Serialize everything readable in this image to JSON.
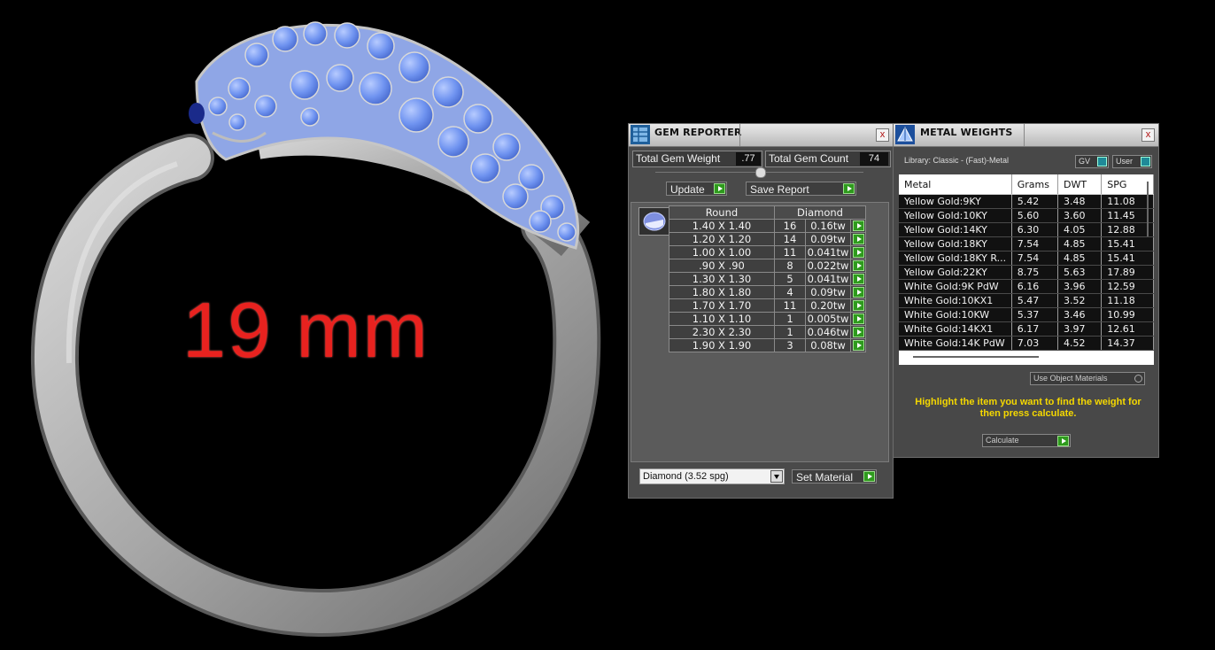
{
  "viewport": {
    "size_label": "19 mm"
  },
  "gem_reporter": {
    "title": "GEM REPORTER",
    "close": "x",
    "total_weight_label": "Total Gem Weight",
    "total_weight_value": ".77",
    "total_count_label": "Total Gem Count",
    "total_count_value": "74",
    "update_label": "Update",
    "save_report_label": "Save Report",
    "table_header": {
      "shape": "Round",
      "material": "Diamond"
    },
    "rows": [
      {
        "size": "1.40 X 1.40",
        "count": "16",
        "weight": "0.16tw"
      },
      {
        "size": "1.20 X 1.20",
        "count": "14",
        "weight": "0.09tw"
      },
      {
        "size": "1.00 X 1.00",
        "count": "11",
        "weight": "0.041tw"
      },
      {
        "size": ".90 X .90",
        "count": "8",
        "weight": "0.022tw"
      },
      {
        "size": "1.30 X 1.30",
        "count": "5",
        "weight": "0.041tw"
      },
      {
        "size": "1.80 X 1.80",
        "count": "4",
        "weight": "0.09tw"
      },
      {
        "size": "1.70 X 1.70",
        "count": "11",
        "weight": "0.20tw"
      },
      {
        "size": "1.10 X 1.10",
        "count": "1",
        "weight": "0.005tw"
      },
      {
        "size": "2.30 X 2.30",
        "count": "1",
        "weight": "0.046tw"
      },
      {
        "size": "1.90 X 1.90",
        "count": "3",
        "weight": "0.08tw"
      }
    ],
    "material_select": "Diamond      (3.52 spg)",
    "set_material_label": "Set Material"
  },
  "metal_weights": {
    "title": "METAL WEIGHTS",
    "close": "x",
    "library": "Library: Classic - (Fast)-Metal",
    "toggle_gv": "GV",
    "toggle_user": "User",
    "columns": [
      "Metal",
      "Grams",
      "DWT",
      "SPG"
    ],
    "rows": [
      [
        "Yellow Gold:9KY",
        "5.42",
        "3.48",
        "11.08"
      ],
      [
        "Yellow Gold:10KY",
        "5.60",
        "3.60",
        "11.45"
      ],
      [
        "Yellow Gold:14KY",
        "6.30",
        "4.05",
        "12.88"
      ],
      [
        "Yellow Gold:18KY",
        "7.54",
        "4.85",
        "15.41"
      ],
      [
        "Yellow Gold:18KY R...",
        "7.54",
        "4.85",
        "15.41"
      ],
      [
        "Yellow Gold:22KY",
        "8.75",
        "5.63",
        "17.89"
      ],
      [
        "White Gold:9K PdW",
        "6.16",
        "3.96",
        "12.59"
      ],
      [
        "White Gold:10KX1",
        "5.47",
        "3.52",
        "11.18"
      ],
      [
        "White Gold:10KW",
        "5.37",
        "3.46",
        "10.99"
      ],
      [
        "White Gold:14KX1",
        "6.17",
        "3.97",
        "12.61"
      ],
      [
        "White Gold:14K PdW",
        "7.03",
        "4.52",
        "14.37"
      ]
    ],
    "use_object_materials": "Use Object Materials",
    "hint": "Highlight the item you want to find the weight for then press calculate.",
    "calculate_label": "Calculate"
  }
}
